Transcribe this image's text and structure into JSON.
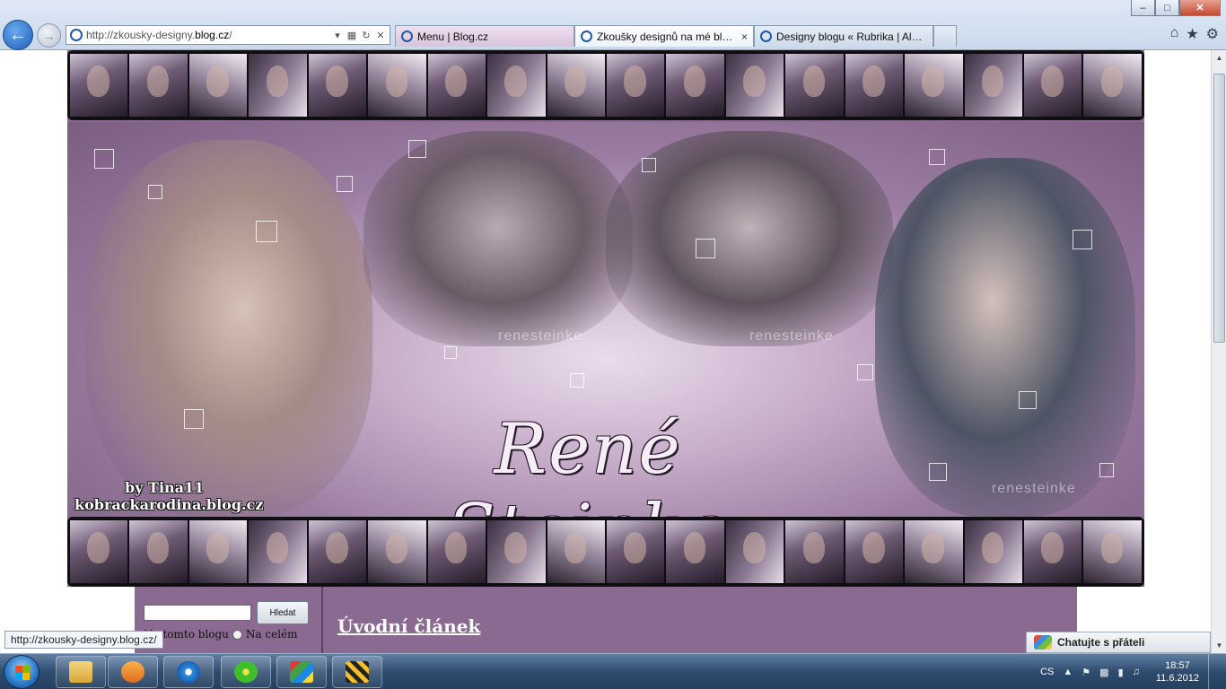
{
  "browser": {
    "address": {
      "prefix": "http://zkousky-designy.",
      "domain": "blog.cz",
      "suffix": "/"
    },
    "tabs": [
      {
        "label": "Menu | Blog.cz",
        "active": false
      },
      {
        "label": "Zkoušky designů na mé blo...",
        "active": true
      },
      {
        "label": "Designy blogu « Rubrika | Alar...",
        "active": false
      }
    ],
    "tab_close_symbol": "×",
    "window_controls": {
      "minimize": "–",
      "maximize": "□",
      "close": "✕"
    }
  },
  "banner": {
    "title": "René Steinke",
    "credit_line1": "by Tina11",
    "credit_line2": "kobrackarodina.blog.cz",
    "watermark": "renesteinke"
  },
  "sidebar": {
    "search_button": "Hledat",
    "radio_this_blog": "Na tomto blogu",
    "radio_all": "Na celém"
  },
  "main": {
    "article_title": "Úvodní článek"
  },
  "status": {
    "hover_url": "http://zkousky-designy.blog.cz/"
  },
  "chat": {
    "label": "Chatujte s přáteli"
  },
  "taskbar": {
    "language": "CS",
    "time": "18:57",
    "date": "11.6.2012"
  },
  "colors": {
    "page_purple": "#8a6a91",
    "taskbar": "#2f4c6f"
  },
  "icons": [
    "back-arrow-icon",
    "forward-arrow-icon",
    "favicon-icon",
    "home-icon",
    "star-icon",
    "gear-icon",
    "windows-logo-icon",
    "folder-icon",
    "media-player-icon",
    "internet-explorer-icon",
    "icq-icon",
    "photo-gallery-icon",
    "movie-maker-icon",
    "chat-icon"
  ]
}
